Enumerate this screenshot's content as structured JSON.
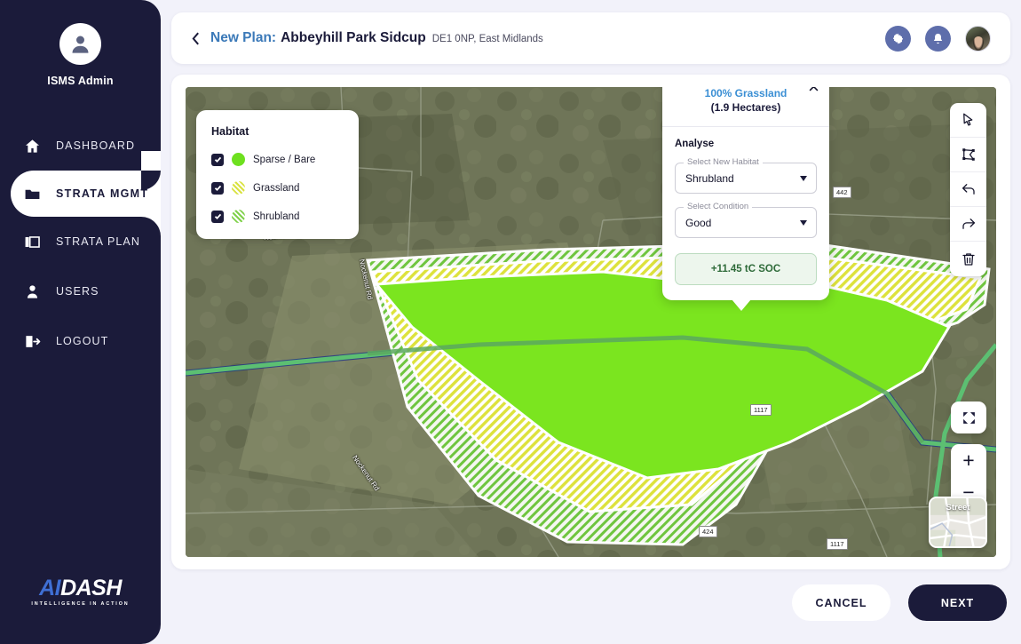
{
  "sidebar": {
    "profile": {
      "name": "ISMS Admin",
      "avatar_icon": "user-avatar-icon"
    },
    "items": [
      {
        "label": "DASHBOARD",
        "icon": "home-icon",
        "active": false
      },
      {
        "label": "STRATA  MGMT",
        "icon": "folder-icon",
        "active": true
      },
      {
        "label": "STRATA PLAN",
        "icon": "layers-icon",
        "active": false
      },
      {
        "label": "USERS",
        "icon": "user-icon",
        "active": false
      },
      {
        "label": "LOGOUT",
        "icon": "logout-icon",
        "active": false
      }
    ],
    "logo": {
      "brand_ai": "AI",
      "brand_dash": "DASH",
      "tagline": "INTELLIGENCE IN ACTION"
    }
  },
  "header": {
    "back_icon": "chevron-left-icon",
    "title_prefix": "New Plan:",
    "title_main": "Abbeyhill Park Sidcup",
    "title_sub": "DE1 0NP, East Midlands",
    "settings_icon": "gear-icon",
    "notifications_icon": "bell-icon",
    "avatar": "user-avatar"
  },
  "legend": {
    "title": "Habitat",
    "items": [
      {
        "label": "Sparse / Bare",
        "checked": true,
        "swatch": "sw-sparse",
        "color": "#6ee01f"
      },
      {
        "label": "Grassland",
        "checked": true,
        "swatch": "sw-grass",
        "color": "#d9e23f"
      },
      {
        "label": "Shrubland",
        "checked": true,
        "swatch": "sw-shrub",
        "color": "#7fd14a"
      }
    ]
  },
  "analyse_panel": {
    "percent_label": "100% Grassland",
    "hectares_label": "(1.9 Hectares)",
    "close_icon": "close-icon",
    "section_title": "Analyse",
    "habitat_field": {
      "label": "Select New Habitat",
      "value": "Shrubland"
    },
    "condition_field": {
      "label": "Select Condition",
      "value": "Good"
    },
    "soc_result": "+11.45 tC SOC",
    "soc_color": "#2f6b3a"
  },
  "map_tools": [
    {
      "name": "select-tool",
      "icon": "cursor-icon"
    },
    {
      "name": "polygon-tool",
      "icon": "polygon-icon"
    },
    {
      "name": "undo-tool",
      "icon": "undo-icon"
    },
    {
      "name": "redo-tool",
      "icon": "redo-icon"
    },
    {
      "name": "delete-tool",
      "icon": "trash-icon"
    }
  ],
  "map_controls": {
    "fullscreen_icon": "fullscreen-icon",
    "zoom_in": "+",
    "zoom_out": "−",
    "basemap_label": "Street"
  },
  "map_labels": {
    "road_names": [
      "Nockenut Rd",
      "Nockenut Rd",
      "Nockenut Rd",
      "Nockenut Rd"
    ],
    "route_shields": [
      "442",
      "1117",
      "424",
      "1117"
    ]
  },
  "footer": {
    "cancel_label": "CANCEL",
    "next_label": "NEXT"
  },
  "colors": {
    "sidebar_bg": "#1b1b3a",
    "page_bg": "#f2f2fa",
    "accent_blue": "#3b79b8",
    "icon_blue": "#5e6eab",
    "sparse_green": "#6ee01f",
    "grassland_yellow": "#d9e23f",
    "shrubland_green": "#7fd14a"
  }
}
